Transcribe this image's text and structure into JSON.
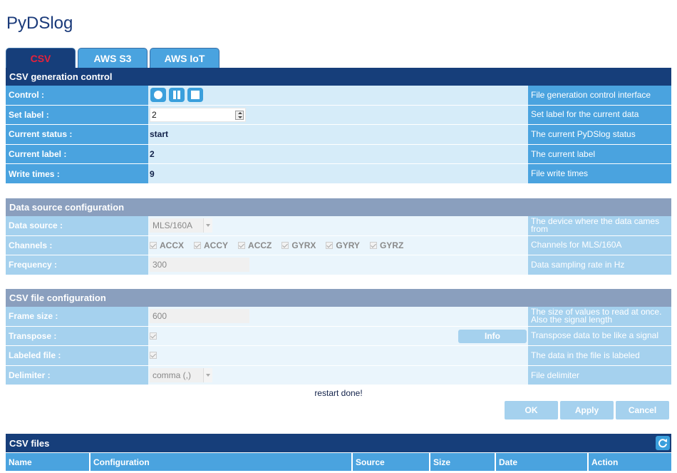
{
  "app": {
    "title": "PyDSlog"
  },
  "tabs": [
    {
      "label": "CSV",
      "active": true
    },
    {
      "label": "AWS S3",
      "active": false
    },
    {
      "label": "AWS IoT",
      "active": false
    }
  ],
  "colors": {
    "primary": "#163e7a",
    "accent": "#4aa3df",
    "active_tab_text": "#e8213a",
    "light": "#d6ecf9"
  },
  "csv_control": {
    "title": "CSV generation control",
    "rows": {
      "control": {
        "label": "Control :",
        "desc": "File generation control interface",
        "icons": [
          "record-icon",
          "pause-icon",
          "stop-icon"
        ]
      },
      "set_label": {
        "label": "Set label :",
        "value": "2",
        "desc": "Set label for the current data"
      },
      "status": {
        "label": "Current status :",
        "value": "start",
        "desc": "The current PyDSlog status"
      },
      "current_label": {
        "label": "Current label :",
        "value": "2",
        "desc": "The current label"
      },
      "write_times": {
        "label": "Write times :",
        "value": "9",
        "desc": "File write times"
      }
    }
  },
  "data_source": {
    "title": "Data source configuration",
    "rows": {
      "source": {
        "label": "Data source :",
        "value": "MLS/160A",
        "desc": "The device where the data cames from"
      },
      "channels": {
        "label": "Channels :",
        "items": [
          "ACCX",
          "ACCY",
          "ACCZ",
          "GYRX",
          "GYRY",
          "GYRZ"
        ],
        "desc": "Channels for MLS/160A"
      },
      "frequency": {
        "label": "Frequency :",
        "value": "300",
        "desc": "Data sampling rate in Hz"
      }
    }
  },
  "csv_file": {
    "title": "CSV file configuration",
    "rows": {
      "frame_size": {
        "label": "Frame size :",
        "value": "600",
        "desc": "The size of values to read at once. Also the signal length"
      },
      "transpose": {
        "label": "Transpose :",
        "info_label": "Info",
        "desc": "Transpose data to be like a signal"
      },
      "labeled": {
        "label": "Labeled file :",
        "desc": "The data in the file is labeled"
      },
      "delimiter": {
        "label": "Delimiter :",
        "value": "comma (,)",
        "desc": "File delimiter"
      }
    }
  },
  "status_message": "restart done!",
  "buttons": {
    "ok": "OK",
    "apply": "Apply",
    "cancel": "Cancel"
  },
  "files": {
    "title": "CSV files",
    "columns": [
      "Name",
      "Configuration",
      "Source",
      "Size",
      "Date",
      "Action"
    ]
  }
}
